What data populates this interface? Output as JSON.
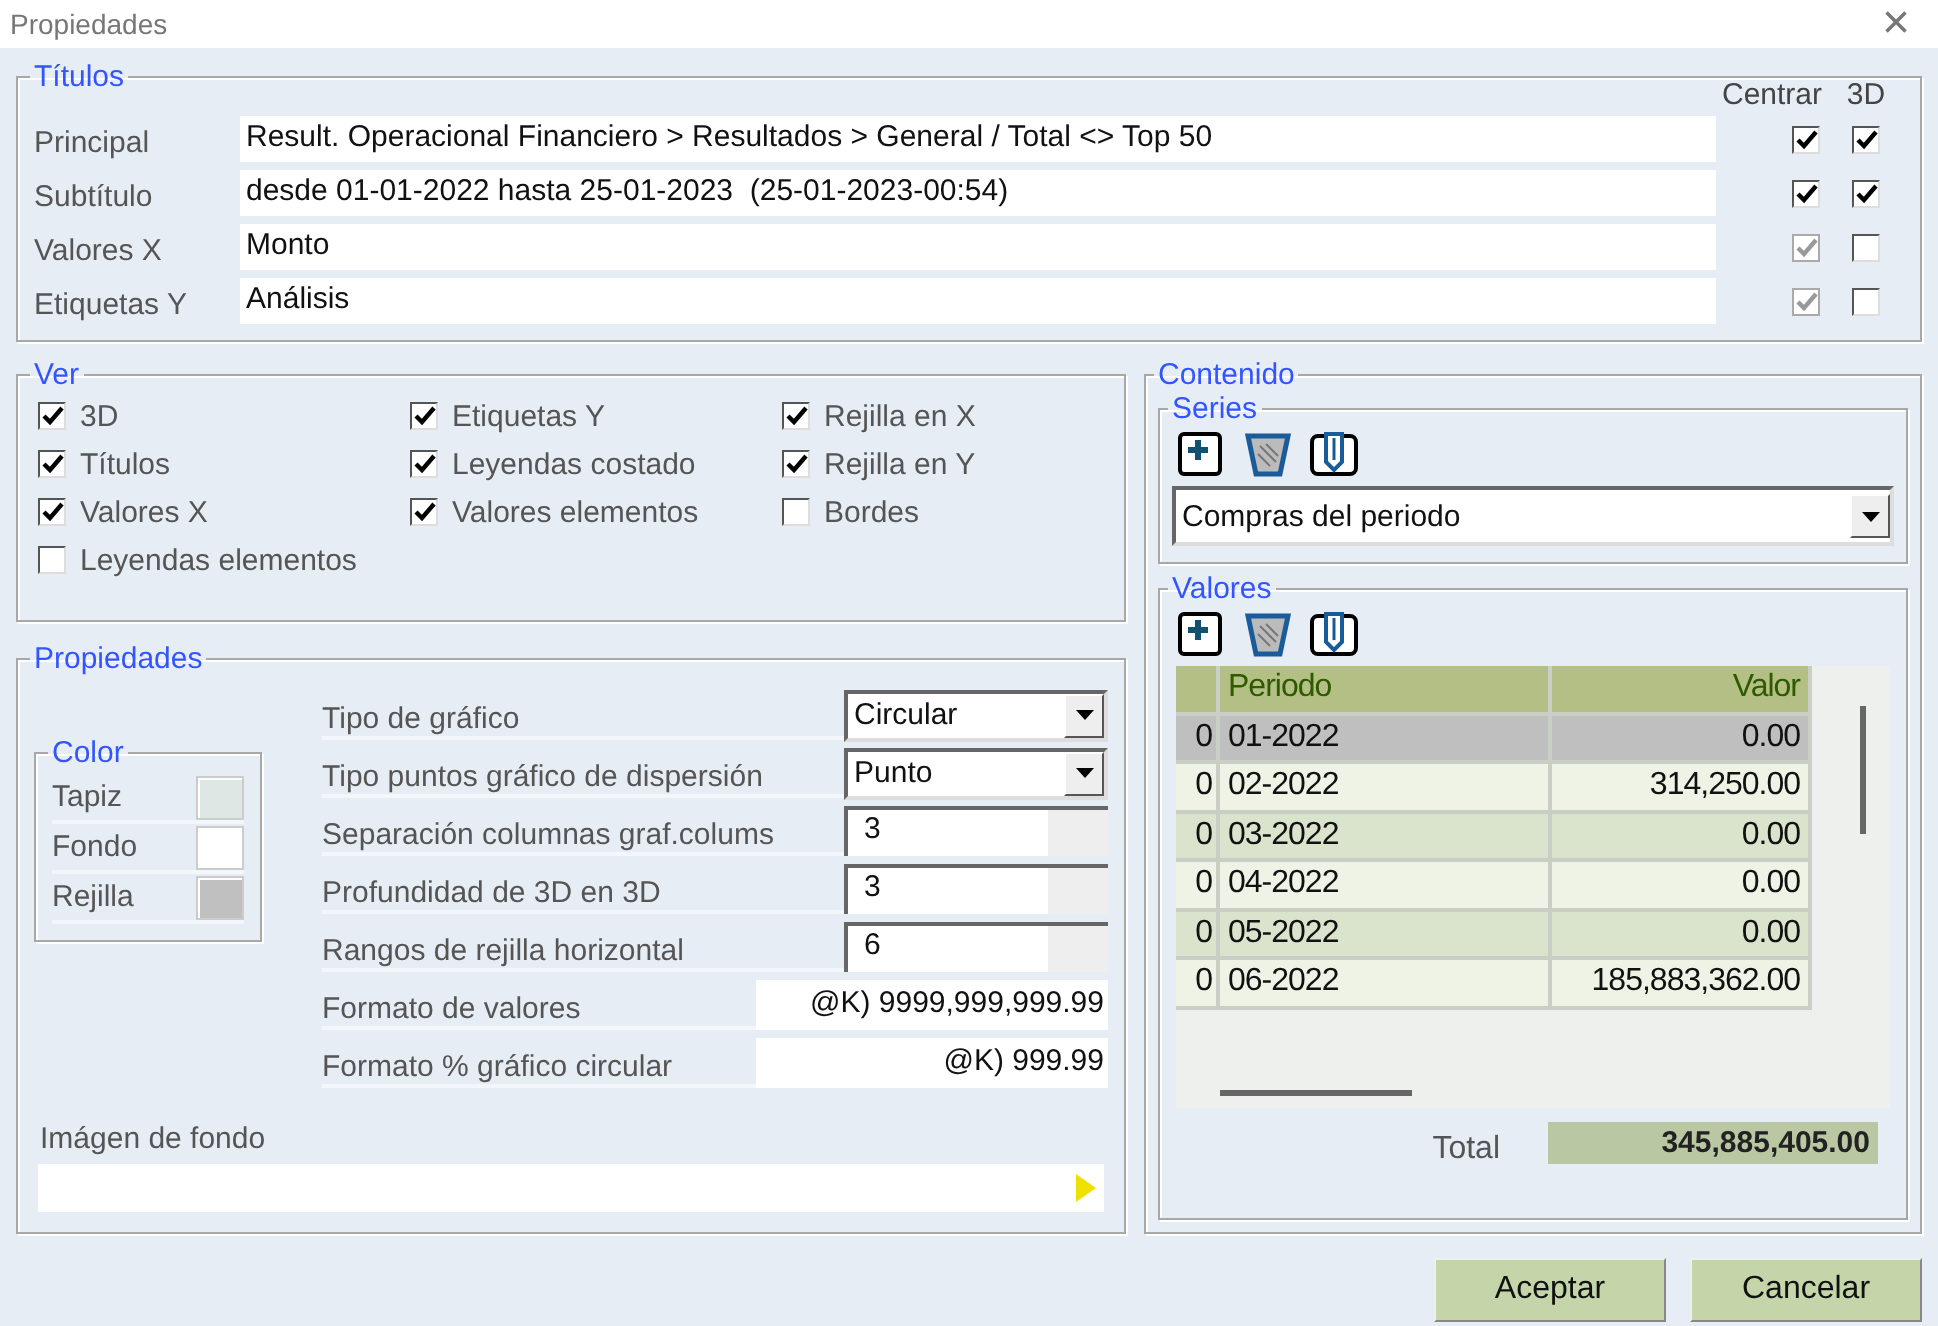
{
  "window": {
    "title": "Propiedades",
    "close": "×"
  },
  "titles": {
    "legend": "Títulos",
    "headers": [
      "Centrar",
      "3D"
    ],
    "rows": [
      {
        "label": "Principal",
        "value": "Result. Operacional Financiero > Resultados > General / Total <> Top 50",
        "center": {
          "checked": true,
          "disabled": false
        },
        "three_d": {
          "checked": true
        }
      },
      {
        "label": "Subtítulo",
        "value": "desde 01-01-2022 hasta 25-01-2023  (25-01-2023-00:54)",
        "center": {
          "checked": true,
          "disabled": false
        },
        "three_d": {
          "checked": true
        }
      },
      {
        "label": "Valores X",
        "value": "Monto",
        "center": {
          "checked": true,
          "disabled": true
        },
        "three_d": {
          "checked": false
        }
      },
      {
        "label": "Etiquetas Y",
        "value": "Análisis",
        "center": {
          "checked": true,
          "disabled": true
        },
        "three_d": {
          "checked": false
        }
      }
    ]
  },
  "view": {
    "legend": "Ver",
    "columns": [
      [
        {
          "label": "3D",
          "checked": true
        },
        {
          "label": "Títulos",
          "checked": true
        },
        {
          "label": "Valores X",
          "checked": true
        },
        {
          "label": "Leyendas elementos",
          "checked": false
        }
      ],
      [
        {
          "label": "Etiquetas Y",
          "checked": true
        },
        {
          "label": "Leyendas costado",
          "checked": true
        },
        {
          "label": "Valores elementos",
          "checked": true
        }
      ],
      [
        {
          "label": "Rejilla en X",
          "checked": true
        },
        {
          "label": "Rejilla en Y",
          "checked": true
        },
        {
          "label": "Bordes",
          "checked": false
        }
      ]
    ]
  },
  "properties": {
    "legend": "Propiedades",
    "color": {
      "legend": "Color",
      "items": [
        {
          "label": "Tapiz",
          "color": "#dde8e4"
        },
        {
          "label": "Fondo",
          "color": "#ffffff"
        },
        {
          "label": "Rejilla",
          "color": "#c0c0c0"
        }
      ]
    },
    "fields": [
      {
        "label": "Tipo de gráfico",
        "kind": "select",
        "value": "Circular"
      },
      {
        "label": "Tipo puntos gráfico de dispersión",
        "kind": "select",
        "value": "Punto"
      },
      {
        "label": "Separación columnas graf.colums",
        "kind": "number",
        "value": "3"
      },
      {
        "label": "Profundidad de 3D en 3D",
        "kind": "number",
        "value": "3"
      },
      {
        "label": "Rangos de rejilla horizontal",
        "kind": "number",
        "value": "6"
      },
      {
        "label": "Formato de valores",
        "kind": "format",
        "value": "@K) 9999,999,999.99"
      },
      {
        "label": "Formato % gráfico circular",
        "kind": "format",
        "value": "@K) 999.99"
      }
    ],
    "image": {
      "label": "Imágen de fondo"
    }
  },
  "content": {
    "legend": "Contenido",
    "series": {
      "legend": "Series",
      "value": "Compras del periodo"
    },
    "values": {
      "legend": "Valores",
      "columns": [
        "Periodo",
        "Valor"
      ],
      "rows": [
        {
          "index": "0",
          "period": "01-2022",
          "value": "0.00",
          "selected": true
        },
        {
          "index": "0",
          "period": "02-2022",
          "value": "314,250.00",
          "selected": false
        },
        {
          "index": "0",
          "period": "03-2022",
          "value": "0.00",
          "selected": false
        },
        {
          "index": "0",
          "period": "04-2022",
          "value": "0.00",
          "selected": false
        },
        {
          "index": "0",
          "period": "05-2022",
          "value": "0.00",
          "selected": false
        },
        {
          "index": "0",
          "period": "06-2022",
          "value": "185,883,362.00",
          "selected": false
        }
      ],
      "total_label": "Total",
      "total": "345,885,405.00"
    }
  },
  "buttons": [
    "Aceptar",
    "Cancelar"
  ]
}
